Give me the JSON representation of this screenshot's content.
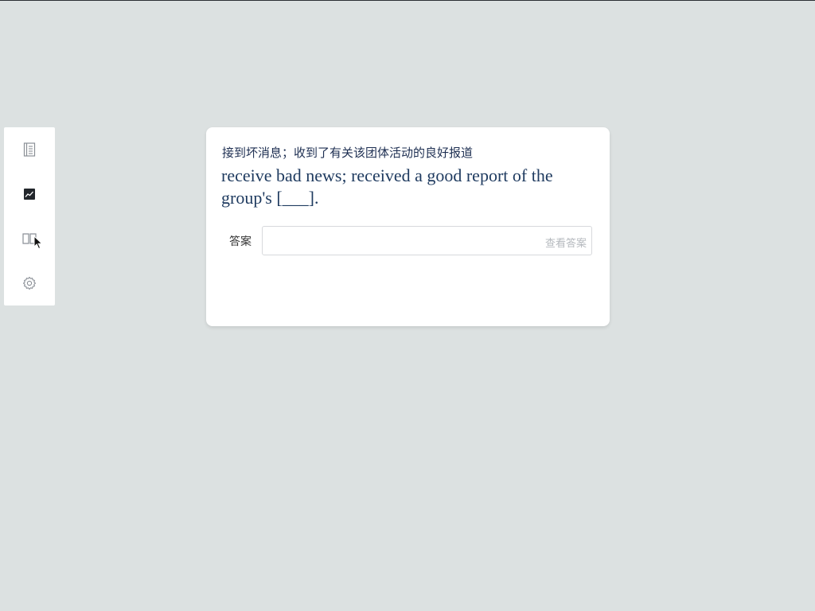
{
  "sidebar": {
    "items": [
      {
        "name": "list",
        "icon": "list-icon"
      },
      {
        "name": "stats",
        "icon": "chart-icon"
      },
      {
        "name": "book",
        "icon": "book-icon"
      },
      {
        "name": "settings",
        "icon": "gear-icon"
      }
    ]
  },
  "card": {
    "chinese_sentence": "接到坏消息；收到了有关该团体活动的良好报道",
    "english_sentence": "receive bad news; received a good report of the group's [___].",
    "answer_label": "答案",
    "answer_value": "",
    "answer_placeholder": "",
    "show_answer_label": "查看答案"
  },
  "colors": {
    "background": "#dce1e1",
    "card": "#ffffff",
    "text_primary": "#1e3a5f",
    "hint": "#b5b9be"
  }
}
